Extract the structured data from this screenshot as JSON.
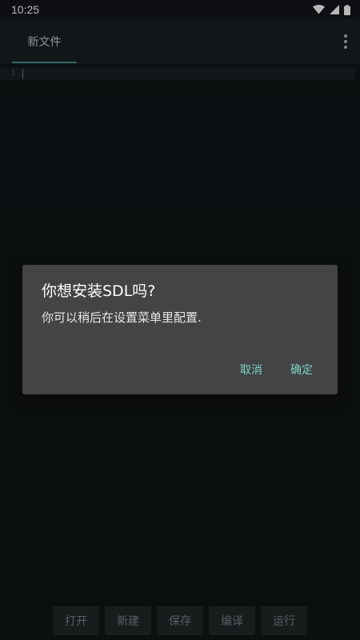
{
  "status_bar": {
    "time": "10:25",
    "icons": [
      "wifi-icon",
      "cellular-signal-icon",
      "battery-icon"
    ]
  },
  "tab": {
    "label": "新文件"
  },
  "menu": {
    "icon": "more-vert-icon"
  },
  "editor": {
    "line_numbers": [
      "1"
    ]
  },
  "dialog": {
    "title": "你想安装SDL吗?",
    "message": "你可以稍后在设置菜单里配置.",
    "cancel_label": "取消",
    "confirm_label": "确定"
  },
  "toolbar": {
    "open_label": "打开",
    "new_label": "新建",
    "save_label": "保存",
    "compile_label": "编译",
    "run_label": "运行"
  },
  "colors": {
    "background": "#111517",
    "app_bar": "#1b1f22",
    "accent": "#4a8f8c",
    "dialog_background": "#424445",
    "dialog_button_text": "#7fd1c7"
  }
}
